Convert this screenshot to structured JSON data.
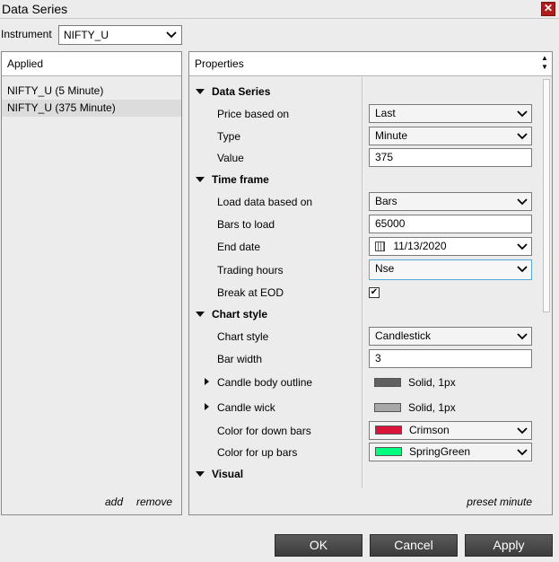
{
  "window": {
    "title": "Data Series",
    "close_icon": "close-icon"
  },
  "instrument": {
    "label": "Instrument",
    "value": "NIFTY_U"
  },
  "applied": {
    "header": "Applied",
    "items": [
      {
        "label": "NIFTY_U (5 Minute)"
      },
      {
        "label": "NIFTY_U (375 Minute)"
      }
    ],
    "add_label": "add",
    "remove_label": "remove"
  },
  "properties": {
    "header": "Properties",
    "preset_label": "preset minute",
    "data_series": {
      "title": "Data Series",
      "price_based_on": {
        "label": "Price based on",
        "value": "Last"
      },
      "type": {
        "label": "Type",
        "value": "Minute"
      },
      "value": {
        "label": "Value",
        "value": "375"
      }
    },
    "time_frame": {
      "title": "Time frame",
      "load_data_based_on": {
        "label": "Load data based on",
        "value": "Bars"
      },
      "bars_to_load": {
        "label": "Bars to load",
        "value": "65000"
      },
      "end_date": {
        "label": "End date",
        "value": "11/13/2020"
      },
      "trading_hours": {
        "label": "Trading hours",
        "value": "Nse"
      },
      "break_at_eod": {
        "label": "Break at EOD",
        "checked": true
      }
    },
    "chart_style": {
      "title": "Chart style",
      "chart_style": {
        "label": "Chart style",
        "value": "Candlestick"
      },
      "bar_width": {
        "label": "Bar width",
        "value": "3"
      },
      "candle_body_outline": {
        "label": "Candle body outline",
        "value": "Solid, 1px",
        "color": "#606060"
      },
      "candle_wick": {
        "label": "Candle wick",
        "value": "Solid, 1px",
        "color": "#a8a8a8"
      },
      "color_down": {
        "label": "Color for down bars",
        "value": "Crimson",
        "color": "#dc143c"
      },
      "color_up": {
        "label": "Color for up bars",
        "value": "SpringGreen",
        "color": "#00ff7f"
      }
    },
    "visual": {
      "title": "Visual"
    }
  },
  "buttons": {
    "ok": "OK",
    "cancel": "Cancel",
    "apply": "Apply"
  }
}
